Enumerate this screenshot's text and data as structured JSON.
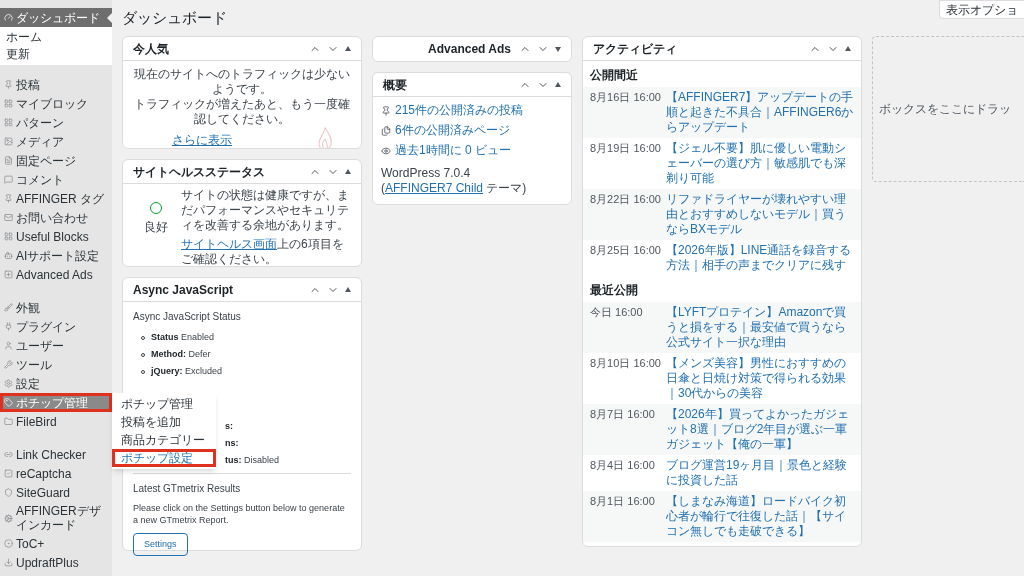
{
  "sidebar": {
    "items": [
      {
        "label": "ダッシュボード",
        "selected": true,
        "open": true,
        "children": [
          {
            "label": "ホーム",
            "selected": false
          },
          {
            "label": "更新",
            "selected": false
          }
        ]
      }
    ],
    "groups": [
      [
        {
          "label": "投稿",
          "selected": false,
          "open": false,
          "annotated": false
        },
        {
          "label": "マイブロック",
          "selected": false,
          "open": false,
          "annotated": false
        },
        {
          "label": "パターン",
          "selected": false,
          "open": false,
          "annotated": false
        },
        {
          "label": "メディア",
          "selected": false,
          "open": false,
          "annotated": false
        },
        {
          "label": "固定ページ",
          "selected": false,
          "open": false,
          "annotated": false
        },
        {
          "label": "コメント",
          "selected": false,
          "open": false,
          "annotated": false
        },
        {
          "label": "AFFINGER タグ",
          "selected": false,
          "open": false,
          "annotated": false
        },
        {
          "label": "お問い合わせ",
          "selected": false,
          "open": false,
          "annotated": false
        },
        {
          "label": "Useful Blocks",
          "selected": false,
          "open": false,
          "annotated": false
        },
        {
          "label": "AIサポート設定",
          "selected": false,
          "open": false,
          "annotated": false
        },
        {
          "label": "Advanced Ads",
          "selected": false,
          "open": false,
          "annotated": false
        }
      ],
      [
        {
          "label": "外観",
          "selected": false,
          "open": false,
          "annotated": false
        },
        {
          "label": "プラグイン",
          "selected": false,
          "open": false,
          "annotated": false
        },
        {
          "label": "ユーザー",
          "selected": false,
          "open": false,
          "annotated": false
        },
        {
          "label": "ツール",
          "selected": false,
          "open": false,
          "annotated": false
        },
        {
          "label": "設定",
          "selected": false,
          "open": false,
          "annotated": false
        },
        {
          "label": "ポチップ管理",
          "selected": false,
          "open": true,
          "annotated": true
        },
        {
          "label": "FileBird",
          "selected": false,
          "open": false,
          "annotated": false
        }
      ],
      [
        {
          "label": "Link Checker",
          "selected": false,
          "open": false,
          "annotated": false
        },
        {
          "label": "reCaptcha",
          "selected": false,
          "open": false,
          "annotated": false
        },
        {
          "label": "SiteGuard",
          "selected": false,
          "open": false,
          "annotated": false
        },
        {
          "label": "AFFINGERデザインカード",
          "selected": false,
          "open": false,
          "annotated": false
        },
        {
          "label": "ToC+",
          "selected": false,
          "open": false,
          "annotated": false
        },
        {
          "label": "UpdraftPlus",
          "selected": false,
          "open": false,
          "annotated": false
        }
      ]
    ]
  },
  "flyout": [
    {
      "label": "ポチップ管理",
      "selected": false,
      "annotated": false
    },
    {
      "label": "投稿を追加",
      "selected": false,
      "annotated": false
    },
    {
      "label": "商品カテゴリー",
      "selected": false,
      "annotated": false
    },
    {
      "label": "ポチップ設定",
      "selected": true,
      "annotated": true
    }
  ],
  "page_title": "ダッシュボード",
  "screen_options": "表示オプショ",
  "popular": {
    "title": "今人気",
    "collapsed": false,
    "message": [
      "現在のサイトへのトラフィックは少ないようです。",
      "トラフィックが増えたあと、もう一度確認してください。"
    ],
    "link": "さらに表示"
  },
  "site_health": {
    "title": "サイトヘルスステータス",
    "collapsed": false,
    "status": "良好",
    "text": "サイトの状態は健康ですが、まだパフォーマンスやセキュリティを改善する余地があります。",
    "link": "サイトヘルス画面",
    "link_suffix": "上の6項目をご確認ください。"
  },
  "async_js": {
    "title": "Async JavaScript",
    "collapsed": false,
    "heading": "Async JavaScript Status",
    "items": [
      {
        "kind": "full",
        "label": "Status",
        "value": "Enabled"
      },
      {
        "kind": "full",
        "label": "Method:",
        "value": "Defer"
      },
      {
        "kind": "full",
        "label": "jQuery:",
        "value": "Excluded"
      },
      {
        "kind": "partial",
        "label": "s:",
        "value": ""
      },
      {
        "kind": "partial",
        "label": "ns:",
        "value": ""
      },
      {
        "kind": "partial",
        "label": "tus:",
        "value": "Disabled"
      }
    ],
    "results_heading": "Latest GTmetrix Results",
    "results_text": "Please click on the Settings button below to generate a new GTmetrix Report.",
    "button": "Settings"
  },
  "advanced_ads": {
    "title": "Advanced Ads",
    "collapsed": true
  },
  "overview": {
    "title": "概要",
    "collapsed": false,
    "posts": "215件の公開済みの投稿",
    "pages": "6件の公開済みページ",
    "views": "過去1時間に 0 ビュー",
    "version_prefix": "WordPress 7.0.4 (",
    "theme_link": "AFFINGER7 Child",
    "version_suffix": " テーマ)"
  },
  "activity": {
    "title": "アクティビティ",
    "collapsed": false,
    "sections": [
      {
        "heading": "公開間近",
        "rows": [
          {
            "date": "8月16日 16:00",
            "title": "【AFFINGER7】アップデートの手順と起きた不具合｜AFFINGER6からアップデート"
          },
          {
            "date": "8月19日 16:00",
            "title": "【ジェル不要】肌に優しい電動シェーバーの選び方｜敏感肌でも深剃り可能"
          },
          {
            "date": "8月22日 16:00",
            "title": "リファドライヤーが壊れやすい理由とおすすめしないモデル｜買うならBXモデル"
          },
          {
            "date": "8月25日 16:00",
            "title": "【2026年版】LINE通話を録音する方法｜相手の声までクリアに残す"
          }
        ]
      },
      {
        "heading": "最近公開",
        "rows": [
          {
            "date": "今日 16:00",
            "title": "【LYFTプロテイン】Amazonで買うと損をする｜最安値で買うなら公式サイト一択な理由"
          },
          {
            "date": "8月10日 16:00",
            "title": "【メンズ美容】男性におすすめの日傘と日焼け対策で得られる効果｜30代からの美容"
          },
          {
            "date": "8月7日 16:00",
            "title": "【2026年】買ってよかったガジェット8選｜ブログ2年目が選ぶ一軍ガジェット【俺の一軍】"
          },
          {
            "date": "8月4日 16:00",
            "title": "ブログ運営19ヶ月目｜景色と経験に投資した話"
          },
          {
            "date": "8月1日 16:00",
            "title": "【しまなみ海道】ロードバイク初心者が輪行で往復した話｜【サイコン無しでも走破できる】"
          }
        ]
      }
    ]
  },
  "drop_zone": "ボックスをここにドラッ"
}
